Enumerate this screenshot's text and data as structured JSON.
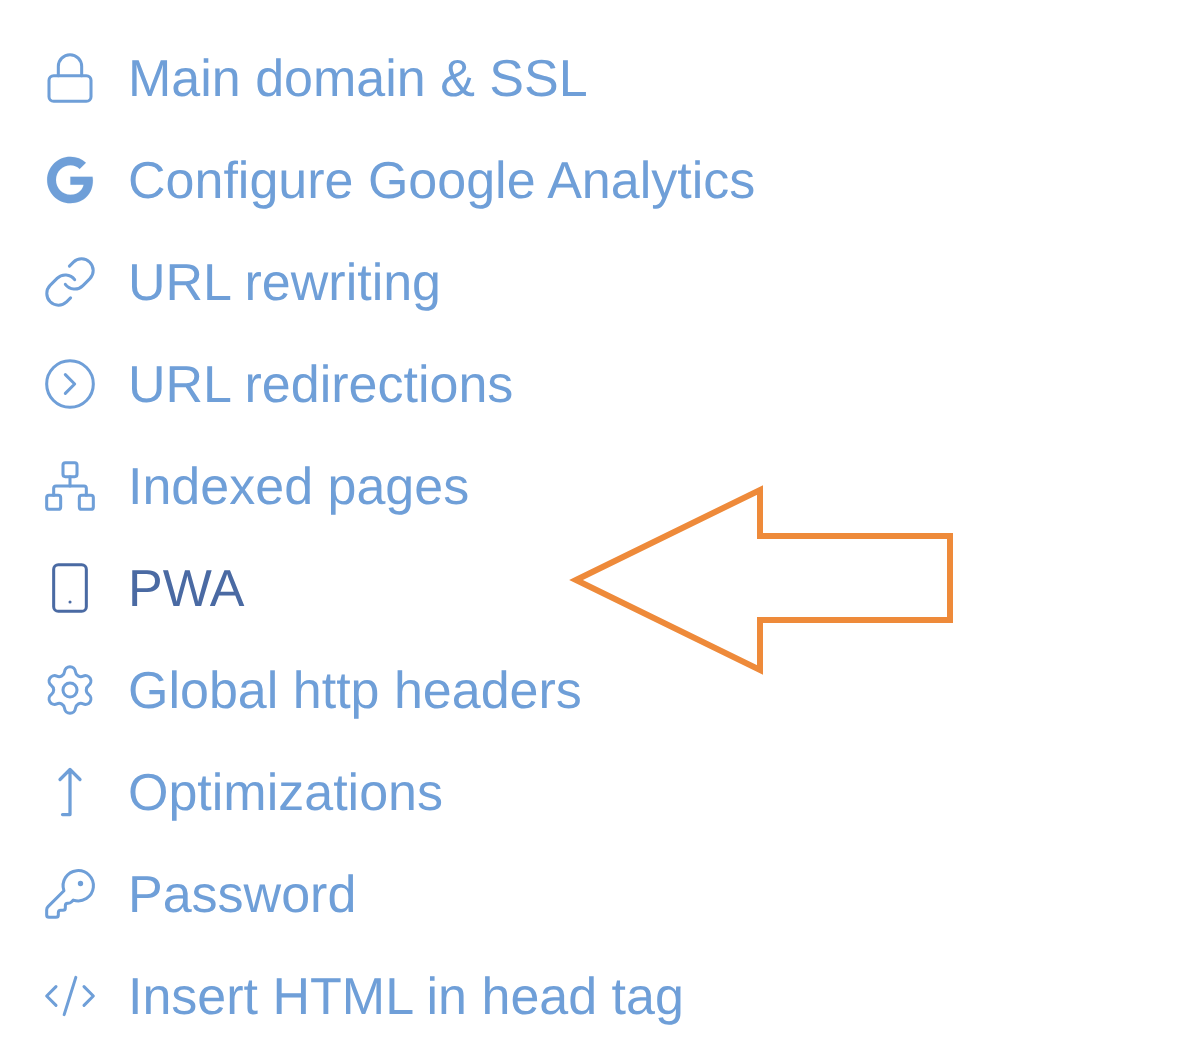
{
  "menu": {
    "items": [
      {
        "kind": "lock",
        "label": "Main domain & SSL",
        "selected": false
      },
      {
        "kind": "google",
        "label": "Configure Google Analytics",
        "selected": false
      },
      {
        "kind": "link",
        "label": "URL rewriting",
        "selected": false
      },
      {
        "kind": "redirect",
        "label": "URL redirections",
        "selected": false
      },
      {
        "kind": "sitemap",
        "label": "Indexed pages",
        "selected": false
      },
      {
        "kind": "phone",
        "label": "PWA",
        "selected": true
      },
      {
        "kind": "gear",
        "label": "Global http headers",
        "selected": false
      },
      {
        "kind": "up",
        "label": "Optimizations",
        "selected": false
      },
      {
        "kind": "key",
        "label": "Password",
        "selected": false
      },
      {
        "kind": "code",
        "label": "Insert HTML in head tag",
        "selected": false
      }
    ]
  },
  "annotation": {
    "kind": "arrow"
  }
}
